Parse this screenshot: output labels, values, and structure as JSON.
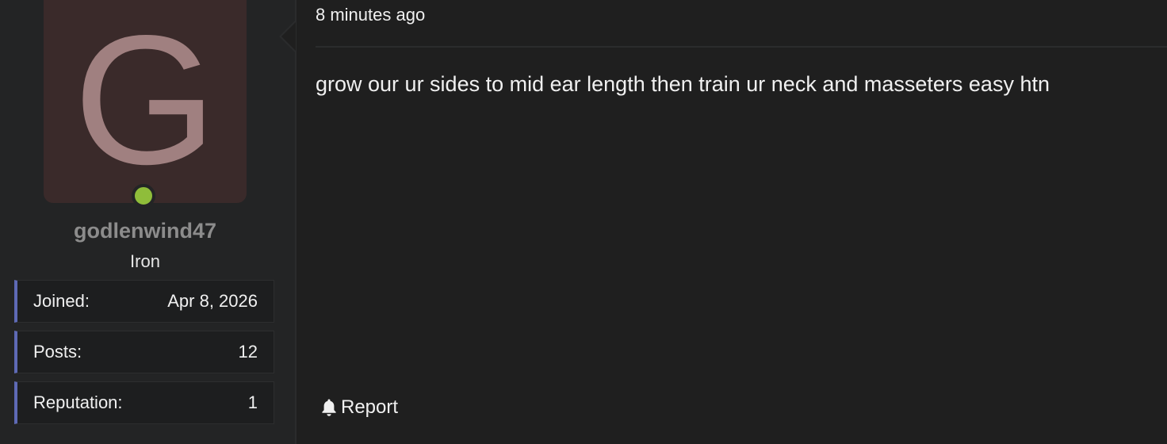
{
  "user": {
    "avatar_letter": "G",
    "username": "godlenwind47",
    "title": "Iron",
    "online": true,
    "stats": [
      {
        "label": "Joined:",
        "value": "Apr 8, 2026"
      },
      {
        "label": "Posts:",
        "value": "12"
      },
      {
        "label": "Reputation:",
        "value": "1"
      }
    ]
  },
  "post": {
    "timestamp": "8 minutes ago",
    "message": "grow our ur sides to mid ear length then train ur neck and masseters easy htn",
    "report_label": "Report",
    "report_icon": "bell-icon"
  },
  "colors": {
    "background": "#1f1f1f",
    "panel": "#232425",
    "avatar_bg": "#3a2a2a",
    "avatar_letter": "#a08080",
    "online": "#8fbd3a",
    "stat_accent": "#5e6ab5",
    "username": "#8c8c8c"
  }
}
